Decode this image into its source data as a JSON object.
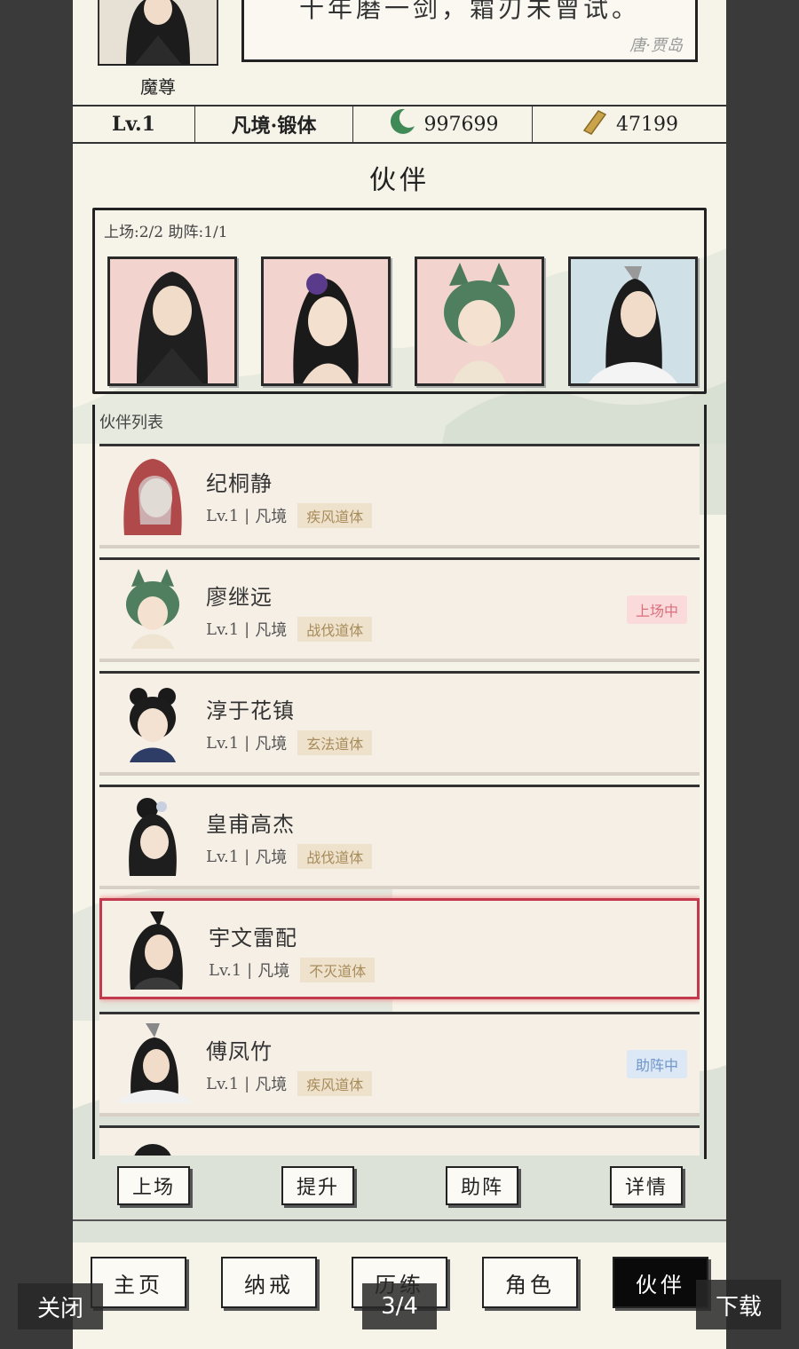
{
  "header": {
    "player_name": "魔尊",
    "poem_line": "十年磨一剑，霜刃未曾试。",
    "poem_author": "唐·贾岛"
  },
  "stats": {
    "level": "Lv.1",
    "realm": "凡境·锻体",
    "jade": "997699",
    "gold": "47199"
  },
  "section_title": "伙伴",
  "team": {
    "count_text": "上场:2/2 助阵:1/1"
  },
  "list": {
    "label": "伙伴列表",
    "rows": [
      {
        "name": "纪桐静",
        "level": "Lv.1",
        "realm": "凡境",
        "body": "疾风道体",
        "status": ""
      },
      {
        "name": "廖继远",
        "level": "Lv.1",
        "realm": "凡境",
        "body": "战伐道体",
        "status": "上场中"
      },
      {
        "name": "淳于花镇",
        "level": "Lv.1",
        "realm": "凡境",
        "body": "玄法道体",
        "status": ""
      },
      {
        "name": "皇甫高杰",
        "level": "Lv.1",
        "realm": "凡境",
        "body": "战伐道体",
        "status": ""
      },
      {
        "name": "宇文雷配",
        "level": "Lv.1",
        "realm": "凡境",
        "body": "不灭道体",
        "status": ""
      },
      {
        "name": "傅凤竹",
        "level": "Lv.1",
        "realm": "凡境",
        "body": "疾风道体",
        "status": "助阵中"
      }
    ]
  },
  "actions": {
    "deploy": "上场",
    "upgrade": "提升",
    "assist": "助阵",
    "details": "详情"
  },
  "nav": {
    "home": "主页",
    "ring": "纳戒",
    "training": "历练",
    "character": "角色",
    "partner": "伙伴"
  },
  "viewer": {
    "close": "关闭",
    "page": "3/4",
    "download": "下载"
  },
  "colors": {
    "background": "#f6f3e8",
    "selected_border": "#c33a4f",
    "deployed_badge": "#d9707b",
    "assist_badge": "#6f97c9",
    "tag_text": "#a78b5a"
  }
}
